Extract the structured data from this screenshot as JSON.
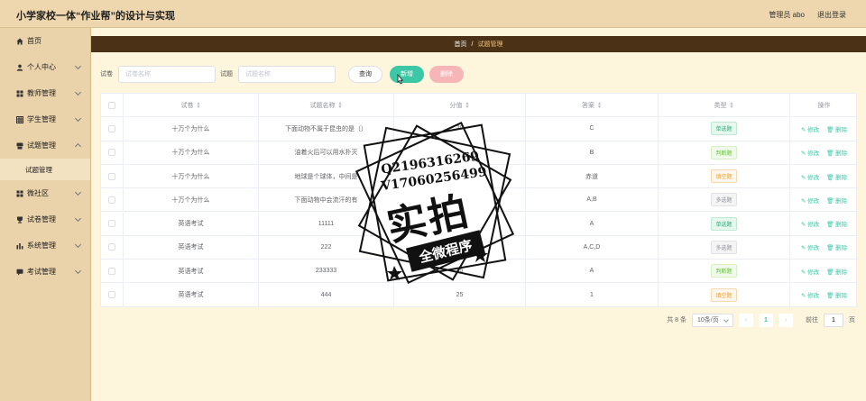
{
  "header": {
    "title": "小学家校一体“作业帮”的设计与实现",
    "user": "管理员 abo",
    "logout": "退出登录"
  },
  "sidebar": {
    "items": [
      {
        "label": "首页",
        "icon": "home-icon"
      },
      {
        "label": "个人中心",
        "icon": "user-icon"
      },
      {
        "label": "教师管理",
        "icon": "grid-icon"
      },
      {
        "label": "学生管理",
        "icon": "table-icon"
      },
      {
        "label": "试题管理",
        "icon": "database-icon"
      },
      {
        "label": "微社区",
        "icon": "grid-icon"
      },
      {
        "label": "试卷管理",
        "icon": "trophy-icon"
      },
      {
        "label": "系统管理",
        "icon": "chart-icon"
      },
      {
        "label": "考试管理",
        "icon": "comment-icon"
      }
    ],
    "sub_item": "试题管理"
  },
  "breadcrumb": {
    "home": "首页",
    "sep": "/",
    "current": "试题管理"
  },
  "search": {
    "paper_label": "试卷",
    "paper_placeholder": "试卷名称",
    "question_label": "试题",
    "question_placeholder": "试题名称",
    "query_btn": "查询",
    "add_btn": "新增",
    "delete_btn": "删除"
  },
  "table": {
    "headers": [
      "试卷",
      "试题名称",
      "分值",
      "答案",
      "类型",
      "操作"
    ],
    "edit_label": "修改",
    "delete_label": "删除",
    "rows": [
      {
        "paper": "十万个为什么",
        "question": "下面动物不属于昆虫的是（）",
        "score": "20",
        "answer": "C",
        "type": "单选题",
        "tag": "single"
      },
      {
        "paper": "十万个为什么",
        "question": "油着火后可以用水扑灭",
        "score": "20",
        "answer": "B",
        "type": "判断题",
        "tag": "judge"
      },
      {
        "paper": "十万个为什么",
        "question": "地球是个球体，中间是",
        "score": "30",
        "answer": "赤道",
        "type": "填空题",
        "tag": "fill"
      },
      {
        "paper": "十万个为什么",
        "question": "下面动物中会流汗的有",
        "score": "30",
        "answer": "A,B",
        "type": "多选题",
        "tag": "multi"
      },
      {
        "paper": "英语考试",
        "question": "11111",
        "score": "25",
        "answer": "A",
        "type": "单选题",
        "tag": "single"
      },
      {
        "paper": "英语考试",
        "question": "222",
        "score": "25",
        "answer": "A,C,D",
        "type": "多选题",
        "tag": "multi"
      },
      {
        "paper": "英语考试",
        "question": "233333",
        "score": "25",
        "answer": "A",
        "type": "判断题",
        "tag": "judge"
      },
      {
        "paper": "英语考试",
        "question": "444",
        "score": "25",
        "answer": "1",
        "type": "填空题",
        "tag": "fill"
      }
    ]
  },
  "pagination": {
    "total": "共 8 条",
    "page_size": "10条/页",
    "prev": "‹",
    "current": "1",
    "next": "›",
    "goto": "前往",
    "goto_value": "1",
    "page_unit": "页"
  },
  "watermark": {
    "line1": "Q2196316269",
    "line2": "V17060256499",
    "big": "实拍",
    "band": "全微程序"
  }
}
